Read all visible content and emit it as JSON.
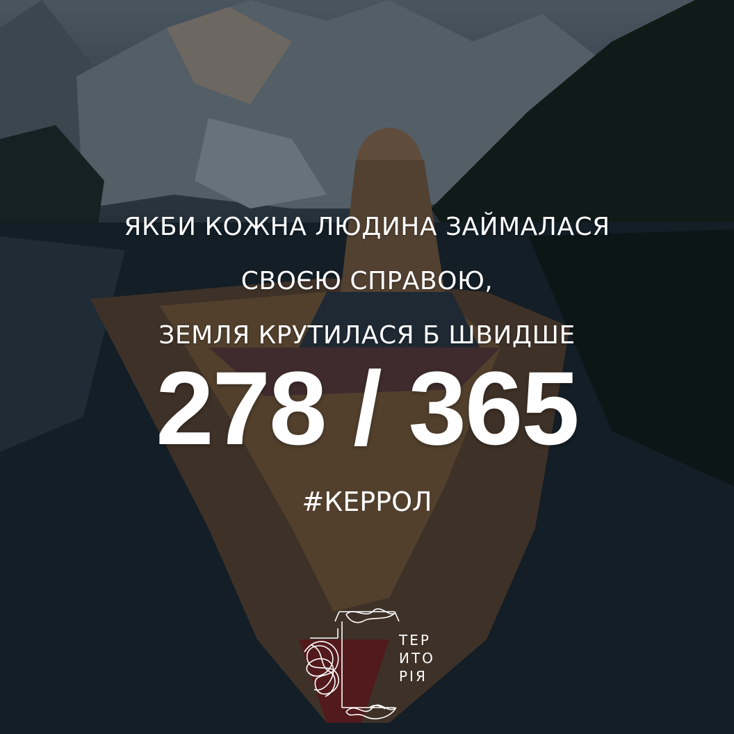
{
  "quote": {
    "line1": "ЯКБИ КОЖНА ЛЮДИНА ЗАЙМАЛАСЯ",
    "line2": "СВОЄЮ СПРАВОЮ,",
    "line3": "ЗЕМЛЯ КРУТИЛАСЯ Б ШВИДШЕ"
  },
  "counter": "278 / 365",
  "hashtag": "#КЕРРОЛ",
  "logo": {
    "line1": "ТЕР",
    "line2": "ИТО",
    "line3": "РІЯ",
    "icon": "scribble-frame-icon"
  },
  "background": {
    "scene": "mountain lake with a woman sitting in a wooden boat",
    "colors": {
      "sky": "#6d7a86",
      "water": "#1a242e",
      "forest": "#142019",
      "boat": "#6b4a2e",
      "text": "#ffffff"
    }
  }
}
